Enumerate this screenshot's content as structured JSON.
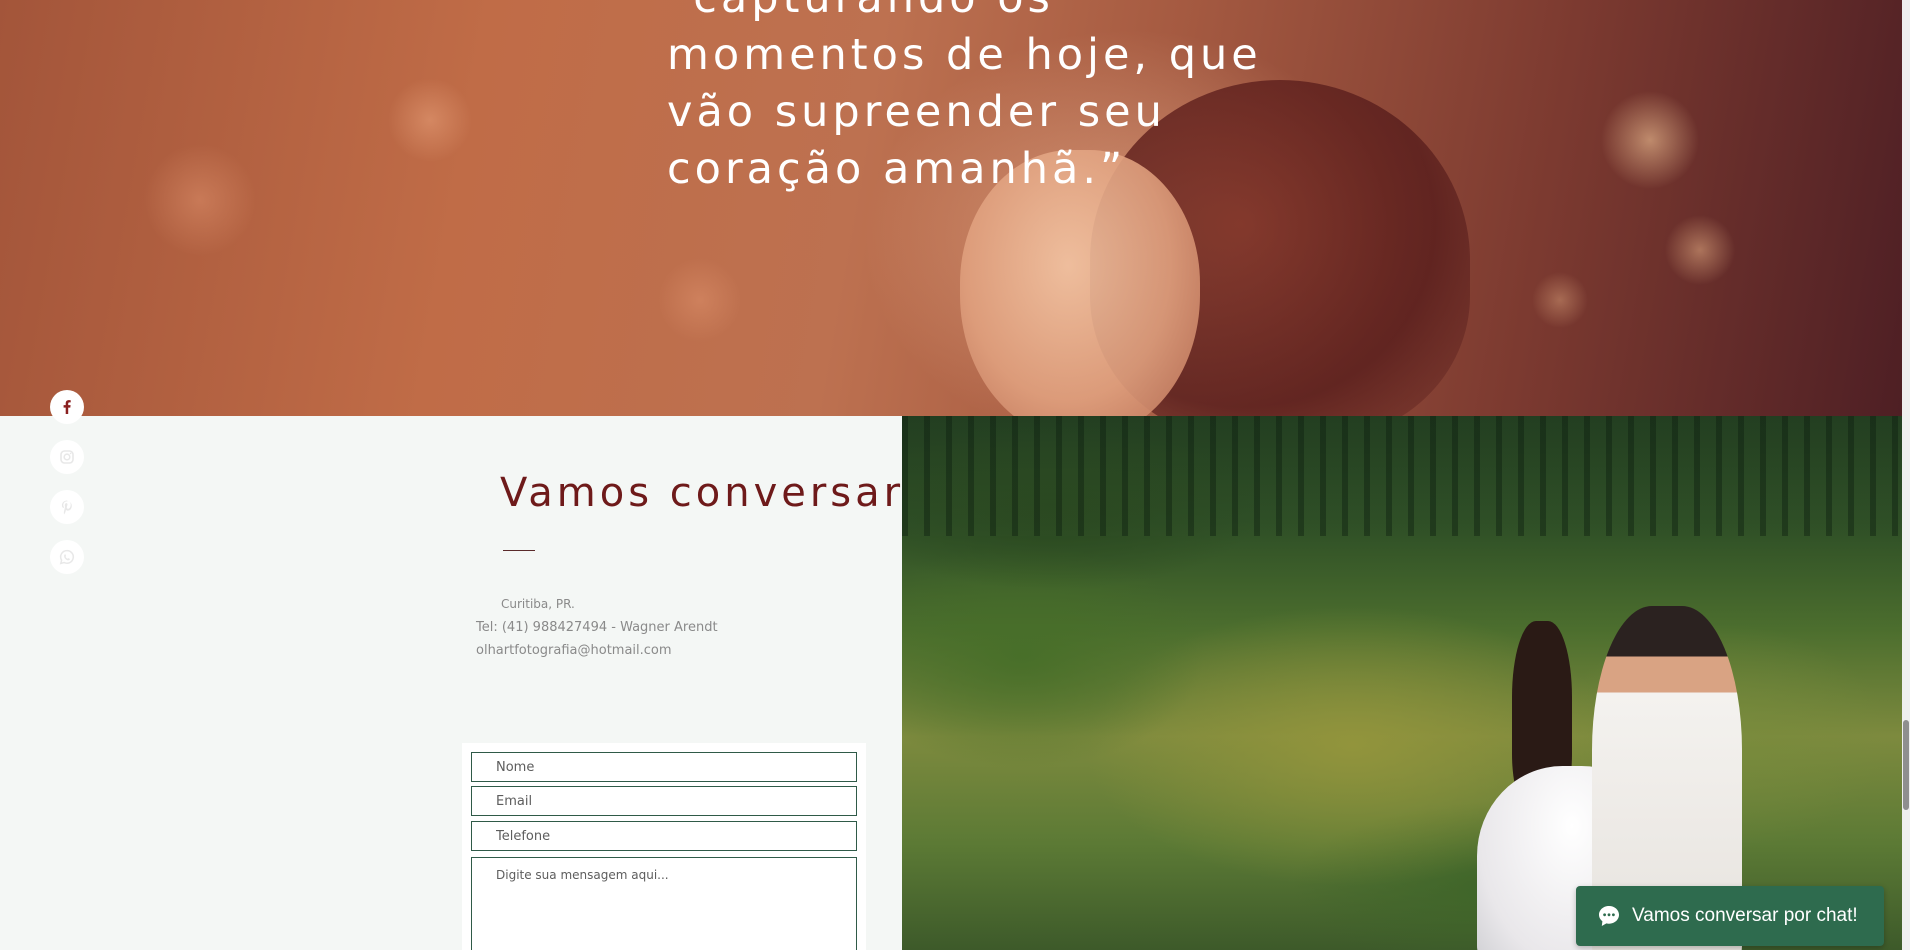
{
  "hero": {
    "quote_lines": [
      "“capturando os",
      "momentos de hoje, que",
      "vão supreender seu",
      "coração amanhã.”"
    ]
  },
  "social": {
    "items": [
      {
        "icon": "facebook-icon"
      },
      {
        "icon": "instagram-icon"
      },
      {
        "icon": "pinterest-icon"
      },
      {
        "icon": "whatsapp-icon"
      }
    ]
  },
  "contact": {
    "title": "Vamos conversar",
    "city": "Curitiba, PR.",
    "phone": "Tel: (41) 988427494 - Wagner Arendt",
    "email": "olhartfotografia@hotmail.com"
  },
  "form": {
    "name_placeholder": "Nome",
    "email_placeholder": "Email",
    "phone_placeholder": "Telefone",
    "message_placeholder": "Digite sua mensagem aqui..."
  },
  "chat": {
    "label": "Vamos conversar por chat!",
    "icon": "chat-bubble-icon"
  },
  "colors": {
    "accent_green": "#2e6b4e",
    "title_red": "#6e1a1a",
    "panel_bg": "#f4f7f5"
  }
}
